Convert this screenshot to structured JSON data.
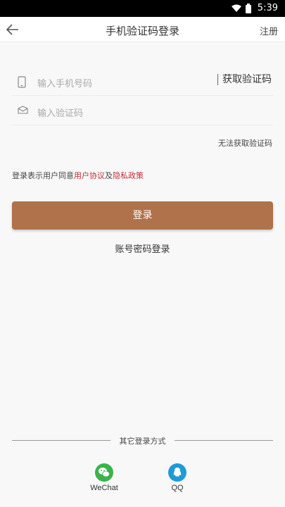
{
  "status_bar": {
    "time": "5:39",
    "wifi_icon": "wifi-icon",
    "battery_icon": "battery-icon"
  },
  "nav": {
    "title": "手机验证码登录",
    "register_label": "注册",
    "back_icon": "arrow-left-icon"
  },
  "form": {
    "phone_placeholder": "输入手机号码",
    "code_placeholder": "输入验证码",
    "get_code_label": "获取验证码",
    "cant_get_code": "无法获取验证码"
  },
  "agreement": {
    "prefix": "登录表示用户同意",
    "user_agreement": "用户协议",
    "and": "及",
    "privacy_policy": "隐私政策"
  },
  "login_button": "登录",
  "password_login": "账号密码登录",
  "other_login": {
    "title": "其它登录方式",
    "options": [
      {
        "label": "WeChat",
        "icon": "wechat-icon"
      },
      {
        "label": "QQ",
        "icon": "qq-icon"
      }
    ]
  },
  "colors": {
    "accent": "#b0724b",
    "link": "#c0303a",
    "wechat": "#3bb34a",
    "qq": "#1e9bd7"
  }
}
